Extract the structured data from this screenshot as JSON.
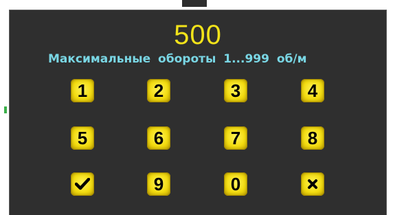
{
  "dialog": {
    "value": "500",
    "caption": "Максимальные  обороты  1...999  об/м"
  },
  "keypad": {
    "keys": [
      "1",
      "2",
      "3",
      "4",
      "5",
      "6",
      "7",
      "8",
      "9",
      "0"
    ],
    "confirm_icon": "check-icon",
    "cancel_icon": "close-icon"
  },
  "colors": {
    "background": "#2f2f2f",
    "value_text": "#f2e31a",
    "caption_text": "#79d6e4",
    "key_face": "#f3dc10",
    "key_text": "#000000"
  }
}
